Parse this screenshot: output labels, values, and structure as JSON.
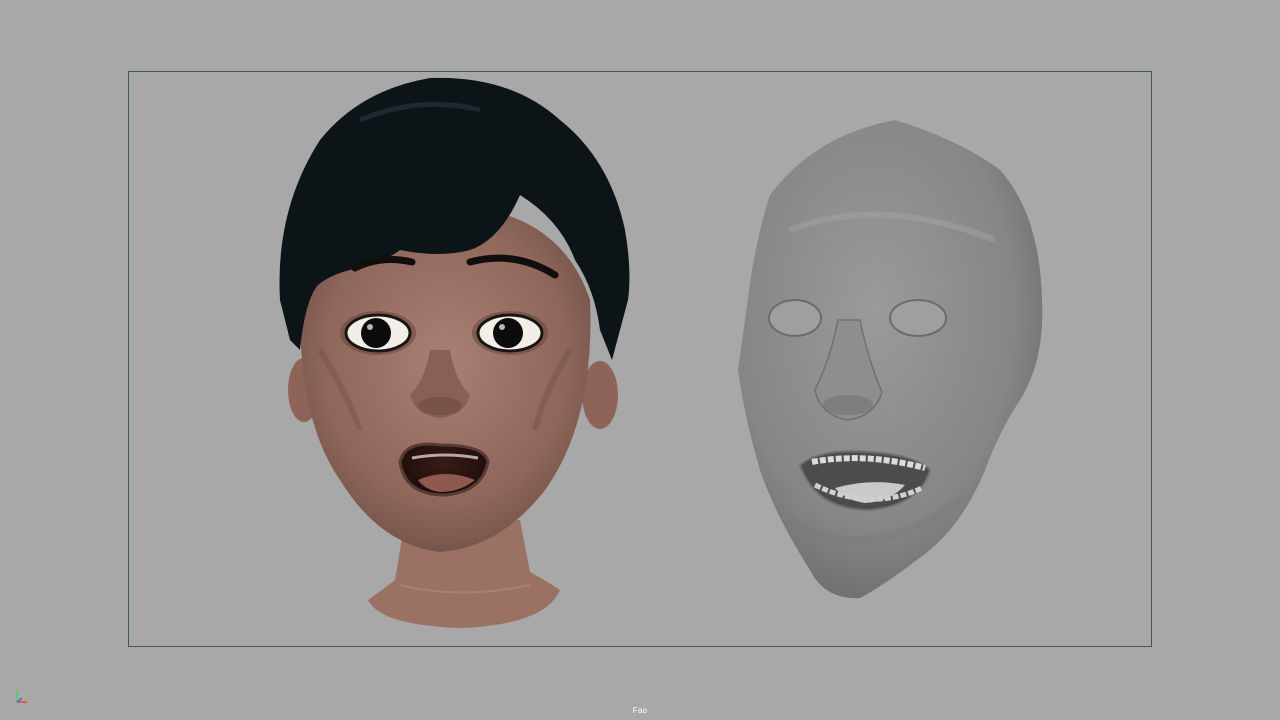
{
  "viewport": {
    "camera_name": "Fao",
    "background_color": "#a8a8a8",
    "gate_border_color": "#3f5a52"
  },
  "objects": [
    {
      "name": "cartoon-child-head",
      "shading": "textured",
      "skin_color": "#9a7163",
      "hair_color": "#0c1418"
    },
    {
      "name": "blendshape-face",
      "shading": "smooth-gray",
      "color": "#8b8b8b"
    }
  ],
  "gizmo": {
    "x_color": "#e0453a",
    "y_color": "#4ccf5a",
    "z_color": "#3a6fe0"
  }
}
